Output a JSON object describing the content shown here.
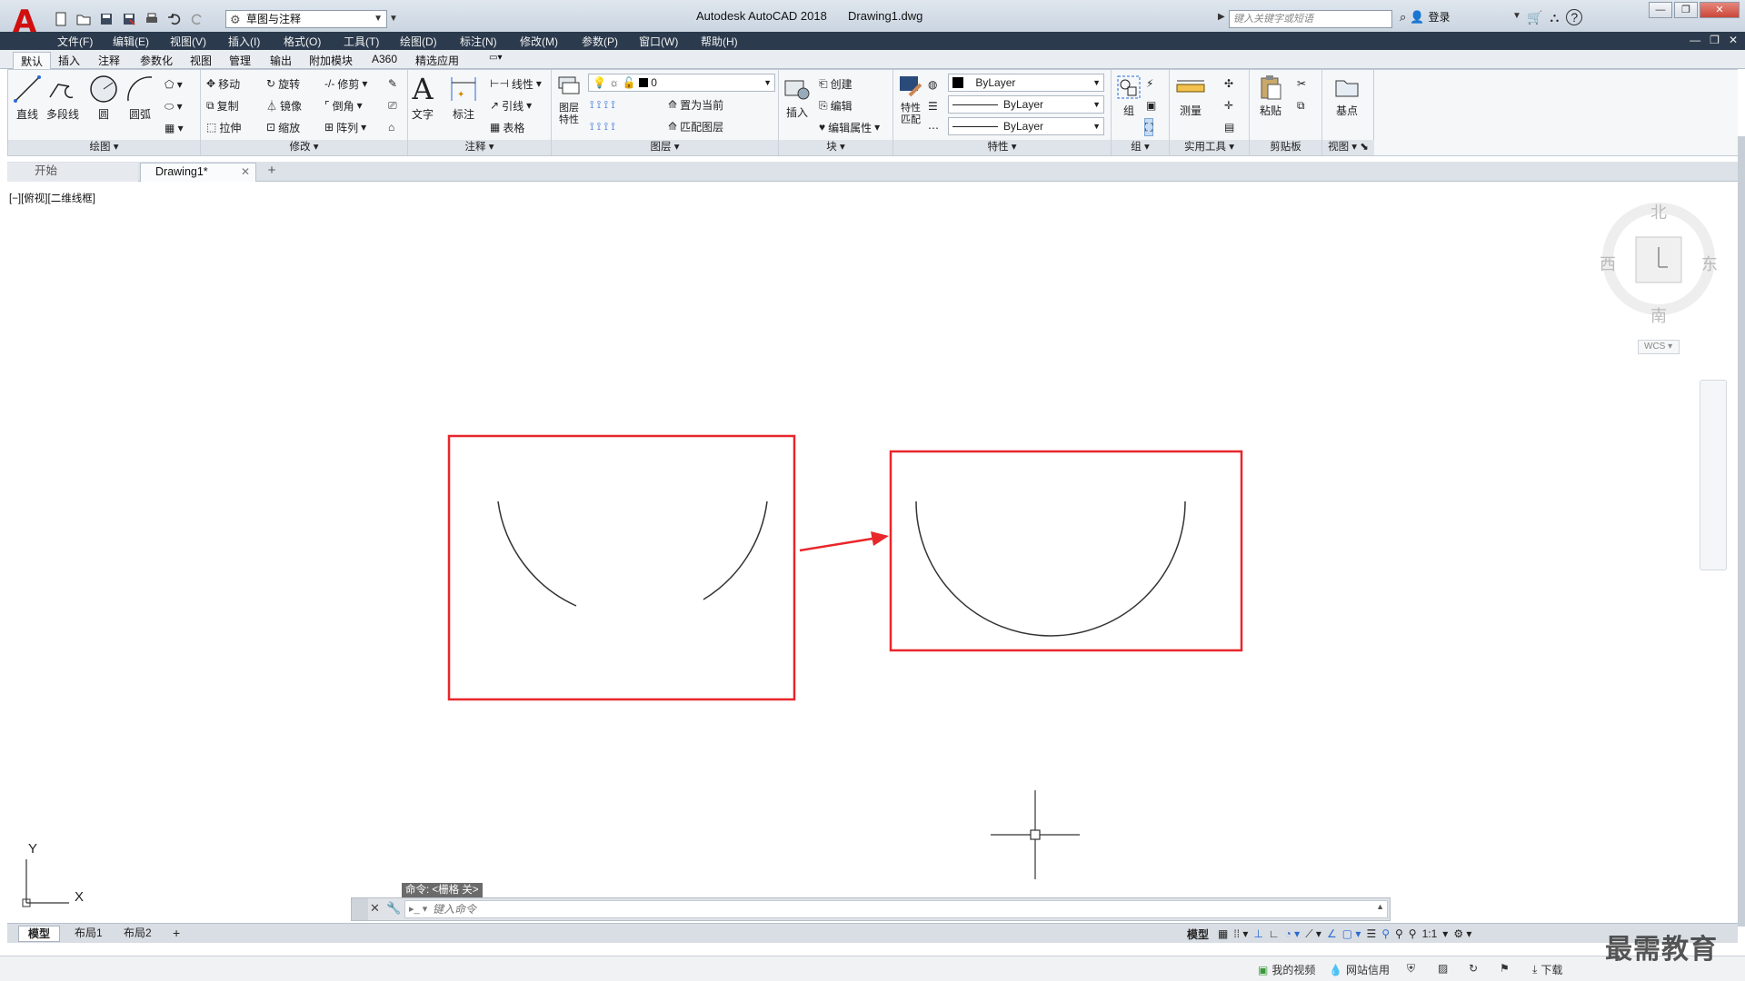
{
  "titlebar": {
    "logo": "A",
    "workspace": "草图与注释",
    "app_title": "Autodesk AutoCAD 2018",
    "file_title": "Drawing1.dwg",
    "search_placeholder": "键入关键字或短语",
    "signin": "登录"
  },
  "menubar": [
    "文件(F)",
    "编辑(E)",
    "视图(V)",
    "插入(I)",
    "格式(O)",
    "工具(T)",
    "绘图(D)",
    "标注(N)",
    "修改(M)",
    "参数(P)",
    "窗口(W)",
    "帮助(H)"
  ],
  "ribbon_tabs": [
    "默认",
    "插入",
    "注释",
    "参数化",
    "视图",
    "管理",
    "输出",
    "附加模块",
    "A360",
    "精选应用"
  ],
  "ribbon": {
    "draw": {
      "title": "绘图",
      "line": "直线",
      "polyline": "多段线",
      "circle": "圆",
      "arc": "圆弧"
    },
    "modify": {
      "title": "修改",
      "move": "移动",
      "rotate": "旋转",
      "trim": "修剪",
      "copy": "复制",
      "mirror": "镜像",
      "fillet": "倒角",
      "stretch": "拉伸",
      "scale": "缩放",
      "array": "阵列"
    },
    "annotation": {
      "title": "注释",
      "text": "文字",
      "dimension": "标注",
      "linear": "线性",
      "leader": "引线",
      "table": "表格"
    },
    "layers": {
      "title": "图层",
      "layer_props": "图层\n特性",
      "layer_value": "0",
      "set_current": "置为当前",
      "match_layer": "匹配图层"
    },
    "block": {
      "title": "块",
      "insert": "插入",
      "create": "创建",
      "edit": "编辑",
      "edit_attr": "编辑属性"
    },
    "properties": {
      "title": "特性",
      "match": "特性\n匹配",
      "color": "ByLayer",
      "lineweight": "ByLayer",
      "linetype": "ByLayer"
    },
    "groups": {
      "title": "组",
      "group": "组"
    },
    "utilities": {
      "title": "实用工具",
      "measure": "测量"
    },
    "clipboard": {
      "title": "剪贴板",
      "paste": "粘贴"
    },
    "view": {
      "title": "视图",
      "base": "基点"
    }
  },
  "file_tabs": {
    "start": "开始",
    "drawing": "Drawing1*"
  },
  "viewport_label": "[−][俯视][二维线框]",
  "viewcube": {
    "north": "北",
    "south": "南",
    "east": "东",
    "west": "西",
    "wcs": "WCS"
  },
  "ucs": {
    "x": "X",
    "y": "Y"
  },
  "command": {
    "history": "命令: <栅格 关>",
    "placeholder": "键入命令"
  },
  "layout_tabs": [
    "模型",
    "布局1",
    "布局2"
  ],
  "status": {
    "model": "模型",
    "scale": "1:1"
  },
  "taskbar": {
    "my_video": "我的视频",
    "network": "网站信用",
    "download": "下载"
  },
  "watermark": "最需教育",
  "colors": {
    "highlight_red": "#e8262b",
    "arc_stroke": "#333333",
    "menubar_bg": "#2b3a4d",
    "logo_red": "#d10f0f"
  }
}
